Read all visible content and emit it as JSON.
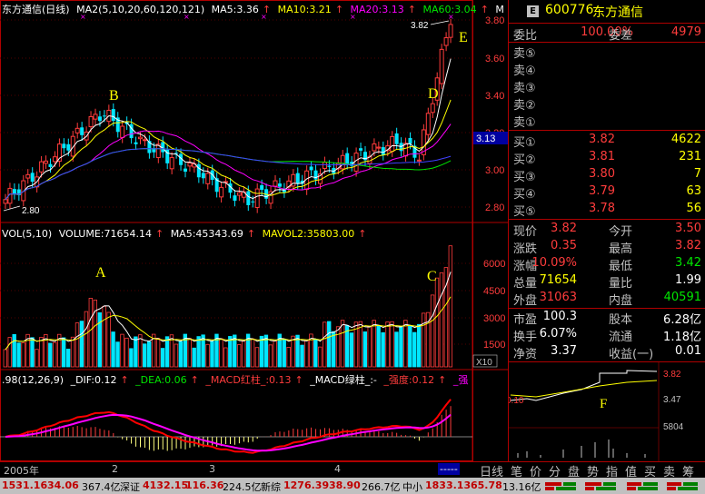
{
  "legend": {
    "title": "东方通信(日线)",
    "ma_group": "MA2(5,10,20,60,120,121)",
    "ma5": "MA5:3.36",
    "ma10": "MA10:3.21",
    "ma20": "MA20:3.13",
    "ma60": "MA60:3.04",
    "overflow": "M"
  },
  "vol_legend": {
    "title": "VOL(5,10)",
    "volume": "VOLUME:71654.14",
    "ma5": "MA5:45343.69",
    "mavol2": "MAVOL2:35803.00"
  },
  "macd_legend": {
    "title": ".98(12,26,9)",
    "dif": "_DIF:0.12",
    "dea": "_DEA:0.06",
    "red_bar": "_MACD红柱_:0.13",
    "green_bar": "_MACD绿柱_:-",
    "strength": "_强度:0.12",
    "strong": "_强"
  },
  "price_axis": [
    "3.80",
    "3.60",
    "3.40",
    "3.20",
    "3.00",
    "2.80"
  ],
  "current_price_tag": "3.13",
  "volume_axis": [
    "6000",
    "4500",
    "3000",
    "1500"
  ],
  "volume_unit": "X10",
  "annotations": {
    "a": "A",
    "b": "B",
    "c": "C",
    "d": "D",
    "e": "E",
    "f": "F",
    "high_label": "3.82",
    "low_label": "2.80"
  },
  "time_axis": {
    "year": "2005年",
    "months": [
      "2",
      "3",
      "4"
    ],
    "scroll": "-----"
  },
  "colors": {
    "up": "#ff3c3c",
    "down": "#00e6ff",
    "ma5": "#ffffff",
    "ma10": "#ffff00",
    "ma20": "#ff00ff",
    "ma60": "#00e600",
    "ma120": "#4040ff",
    "panel_border": "#b00000"
  },
  "stock": {
    "badge": "E",
    "code": "600776",
    "name": "东方通信"
  },
  "bid_ask": {
    "weibi_label": "委比",
    "weibi": "100.00%",
    "weicha_label": "委差",
    "weicha": "4979",
    "asks": [
      {
        "label": "卖⑤",
        "price": "",
        "vol": ""
      },
      {
        "label": "卖④",
        "price": "",
        "vol": ""
      },
      {
        "label": "卖③",
        "price": "",
        "vol": ""
      },
      {
        "label": "卖②",
        "price": "",
        "vol": ""
      },
      {
        "label": "卖①",
        "price": "",
        "vol": ""
      }
    ],
    "bids": [
      {
        "label": "买①",
        "price": "3.82",
        "vol": "4622"
      },
      {
        "label": "买②",
        "price": "3.81",
        "vol": "231"
      },
      {
        "label": "买③",
        "price": "3.80",
        "vol": "7"
      },
      {
        "label": "买④",
        "price": "3.79",
        "vol": "63"
      },
      {
        "label": "买⑤",
        "price": "3.78",
        "vol": "56"
      }
    ]
  },
  "quote": [
    {
      "l1": "现价",
      "v1": "3.82",
      "c1": "red",
      "l2": "今开",
      "v2": "3.50",
      "c2": "red"
    },
    {
      "l1": "涨跌",
      "v1": "0.35",
      "c1": "red",
      "l2": "最高",
      "v2": "3.82",
      "c2": "red"
    },
    {
      "l1": "涨幅",
      "v1": "10.09%",
      "c1": "red",
      "l2": "最低",
      "v2": "3.42",
      "c2": "green"
    },
    {
      "l1": "总量",
      "v1": "71654",
      "c1": "yellow",
      "l2": "量比",
      "v2": "1.99",
      "c2": "white"
    },
    {
      "l1": "外盘",
      "v1": "31063",
      "c1": "red",
      "l2": "内盘",
      "v2": "40591",
      "c2": "green"
    },
    {
      "l1": "市盈",
      "v1": "100.3",
      "c1": "white",
      "l2": "股本",
      "v2": "6.28亿",
      "c2": "white"
    },
    {
      "l1": "换手",
      "v1": "6.07%",
      "c1": "white",
      "l2": "流通",
      "v2": "1.18亿",
      "c2": "white"
    },
    {
      "l1": "净资",
      "v1": "3.37",
      "c1": "white",
      "l2": "收益(一)",
      "v2": "0.01",
      "c2": "white"
    }
  ],
  "mini_chart": {
    "left_value": "0.10",
    "price_high": "3.82",
    "price_mid": "3.47",
    "vol_label": "5804"
  },
  "right_tabs": [
    "日线",
    "笔",
    "价",
    "分",
    "盘",
    "势",
    "指",
    "值",
    "买",
    "卖",
    "筹"
  ],
  "status_bar": {
    "sh": "1531.16",
    "sh_chg": "34.06",
    "sh_amt": "367.4亿",
    "sz_label": "深证",
    "sz": "4132.15",
    "sz_chg": "116.36",
    "sz_amt": "224.5亿",
    "xz_label": "新综",
    "xz": "1276.39",
    "xz_chg": "38.90",
    "xz_amt": "266.7亿",
    "zx_label": "中小",
    "zx": "1833.13",
    "zx_chg": "65.78",
    "zx_amt": "13.16亿"
  }
}
